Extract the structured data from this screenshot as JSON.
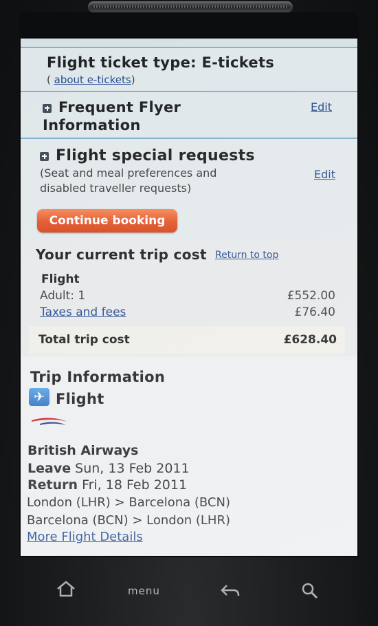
{
  "sections": {
    "ticket_type": {
      "title": "Flight ticket type: E-tickets",
      "open_paren": "(",
      "link": "about e-tickets",
      "close_paren": ")"
    },
    "frequent_flyer": {
      "title_line1": "Frequent Flyer",
      "title_line2": "Information",
      "edit": "Edit"
    },
    "special_requests": {
      "title": "Flight special requests",
      "desc_line1": "(Seat and meal preferences and",
      "desc_line2": "disabled traveller requests)",
      "edit": "Edit"
    }
  },
  "continue_button": "Continue booking",
  "trip_cost": {
    "heading": "Your current trip cost",
    "return_top": "Return to top",
    "flight_label": "Flight",
    "adult_label": "Adult: 1",
    "adult_price": "£552.00",
    "taxes_label": "Taxes and fees",
    "taxes_price": "£76.40",
    "total_label": "Total trip cost",
    "total_price": "£628.40"
  },
  "trip_info": {
    "heading": "Trip Information",
    "flight_heading": "Flight",
    "airline": "British Airways",
    "leave_label": "Leave",
    "leave_date": "Sun, 13 Feb 2011",
    "return_label": "Return",
    "return_date": "Fri, 18 Feb 2011",
    "route_out": "London (LHR) > Barcelona (BCN)",
    "route_back": "Barcelona (BCN) > London (LHR)",
    "more_details": "More Flight Details"
  },
  "nav": {
    "menu": "menu"
  },
  "icons": {
    "plane": "airplane-icon",
    "home": "home-icon",
    "back": "back-icon",
    "search": "search-icon"
  },
  "colors": {
    "accent_button": "#e3562a",
    "link": "#24498f",
    "section_border": "#7fb0cf"
  }
}
